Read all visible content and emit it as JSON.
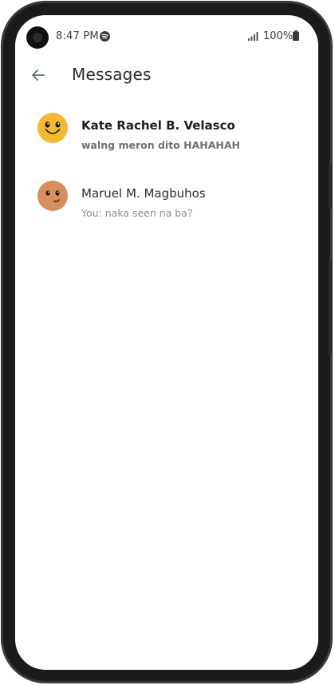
{
  "status_bar": {
    "time": "8:47 PM",
    "battery": "100%",
    "icons": [
      "camera-icon",
      "spotify-icon",
      "signal-icon",
      "battery-icon"
    ]
  },
  "header": {
    "title": "Messages",
    "back_icon": "arrow-left-icon"
  },
  "conversations": [
    {
      "name": "Kate Rachel B. Velasco",
      "preview": "walng meron dito HAHAHAH",
      "unread": true,
      "avatar_color": "#f5b82e"
    },
    {
      "name": "Maruel M. Magbuhos",
      "preview": "You: naka seen na ba?",
      "unread": false,
      "avatar_color": "#d98f5c"
    }
  ],
  "colors": {
    "phone_frame": "#1b1b1b",
    "screen_bg": "#ffffff",
    "spotify_green": "#3a3a3a"
  }
}
